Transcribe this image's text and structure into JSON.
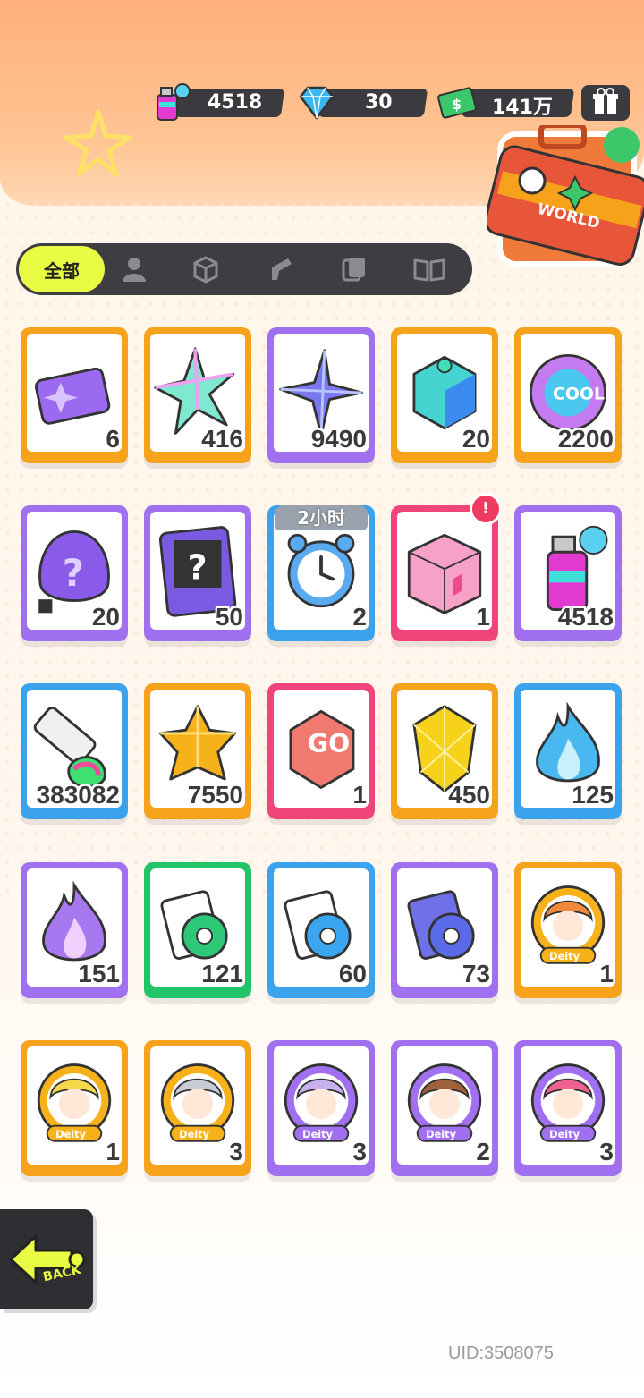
{
  "currencies": [
    {
      "icon": "spray-can-icon",
      "value": "4518"
    },
    {
      "icon": "diamond-icon",
      "value": "30"
    },
    {
      "icon": "cash-icon",
      "value": "141万"
    }
  ],
  "menu_icon": "gift-box-icon",
  "briefcase": {
    "label": "WORLD"
  },
  "tabs": {
    "active_label": "全部",
    "icons": [
      "person-icon",
      "box-icon",
      "spray-gun-icon",
      "card-icon",
      "book-icon"
    ]
  },
  "items": [
    {
      "name": "ticket",
      "count": "6",
      "border": "#f7a21b"
    },
    {
      "name": "rainbow-crystal",
      "count": "416",
      "border": "#f7a21b"
    },
    {
      "name": "purple-star-crystal",
      "count": "9490",
      "border": "#a070f0"
    },
    {
      "name": "color-block",
      "count": "20",
      "border": "#f7a21b"
    },
    {
      "name": "cool-badge",
      "count": "2200",
      "border": "#f7a21b"
    },
    {
      "name": "mystery-egg",
      "count": "20",
      "border": "#a070f0"
    },
    {
      "name": "travel-card",
      "count": "50",
      "border": "#a070f0"
    },
    {
      "name": "alarm-clock",
      "count": "2",
      "border": "#3ba2ee",
      "timer": "2小时"
    },
    {
      "name": "splash-box",
      "count": "1",
      "border": "#f0457a",
      "alert": "!"
    },
    {
      "name": "spray-can",
      "count": "4518",
      "border": "#a070f0"
    },
    {
      "name": "paint-tube",
      "count": "383082",
      "border": "#3ba2ee"
    },
    {
      "name": "gold-crystal",
      "count": "7550",
      "border": "#f7a21b"
    },
    {
      "name": "red-dice",
      "count": "1",
      "border": "#f0457a"
    },
    {
      "name": "yellow-gem",
      "count": "450",
      "border": "#f7a21b"
    },
    {
      "name": "blue-flame",
      "count": "125",
      "border": "#3ba2ee"
    },
    {
      "name": "purple-flame",
      "count": "151",
      "border": "#a070f0"
    },
    {
      "name": "green-film-roll",
      "count": "121",
      "border": "#22c46a"
    },
    {
      "name": "blue-film-roll",
      "count": "60",
      "border": "#3ba2ee"
    },
    {
      "name": "purple-film-roll",
      "count": "73",
      "border": "#a070f0"
    },
    {
      "name": "deity-badge-orange-hair",
      "count": "1",
      "border": "#f7a21b"
    },
    {
      "name": "deity-badge-blonde",
      "count": "1",
      "border": "#f7a21b"
    },
    {
      "name": "deity-badge-silver-hair",
      "count": "3",
      "border": "#f7a21b"
    },
    {
      "name": "deity-badge-lavender-hair",
      "count": "3",
      "border": "#a070f0"
    },
    {
      "name": "deity-badge-brown-hair",
      "count": "2",
      "border": "#a070f0"
    },
    {
      "name": "deity-badge-pink-hair",
      "count": "3",
      "border": "#a070f0"
    }
  ],
  "back_label": "BACK",
  "uid": "UID:3508075"
}
